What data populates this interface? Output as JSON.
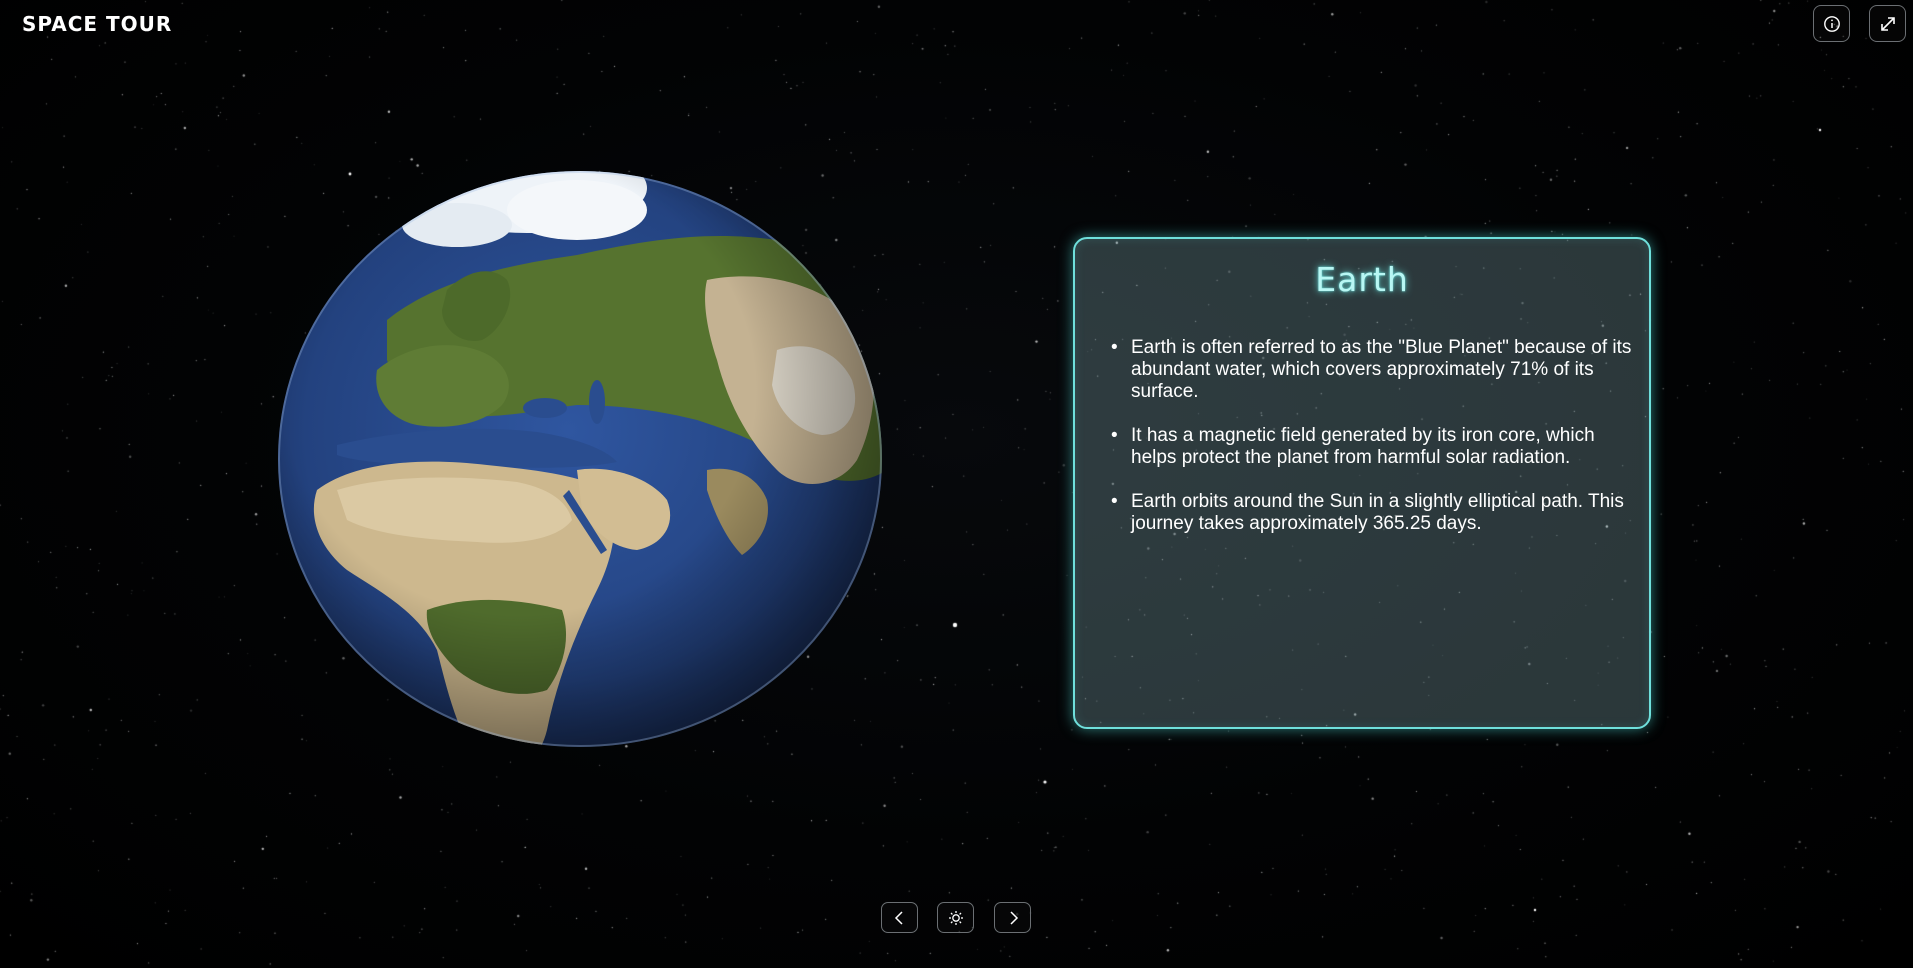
{
  "app": {
    "title": "SPACE TOUR"
  },
  "toolbar": {
    "info_icon": "info-icon",
    "fullscreen_icon": "expand-icon"
  },
  "planet": {
    "name": "Earth",
    "facts": [
      "Earth is often referred to as the \"Blue Planet\" because of its abundant water, which covers approximately 71% of its surface.",
      "It has a magnetic field generated by its iron core, which helps protect the planet from harmful solar radiation.",
      "Earth orbits around the Sun in a slightly elliptical path. This journey takes approximately 365.25 days."
    ]
  },
  "navigation": {
    "prev_icon": "chevron-left-icon",
    "center_icon": "sun-gear-icon",
    "next_icon": "chevron-right-icon"
  },
  "colors": {
    "background": "#000000",
    "card_border": "#6fe0dc",
    "card_title": "#b8f7f4",
    "ocean": "#2a4d8f",
    "land": "#c8b78f",
    "vegetation": "#4f6b2c",
    "ice": "#e8eef4"
  }
}
